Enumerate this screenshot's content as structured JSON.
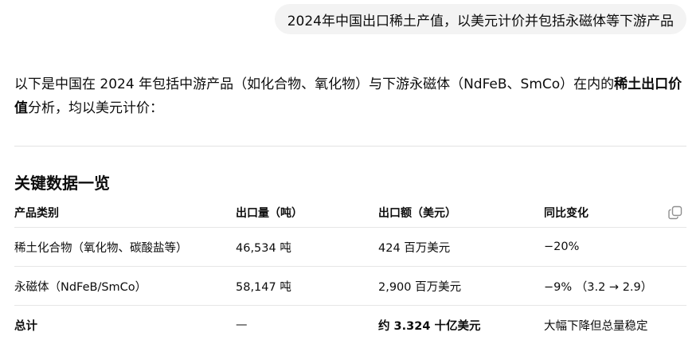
{
  "user_message": "2024年中国出口稀土产值，以美元计价并包括永磁体等下游产品",
  "intro": {
    "text_before": "以下是中国在 2024 年包括中游产品（如化合物、氧化物）与下游永磁体（NdFeB、SmCo）在内的",
    "text_bold": "稀土出口价值",
    "text_after": "分析，均以美元计价："
  },
  "section_title": "关键数据一览",
  "table": {
    "headers": [
      "产品类别",
      "出口量（吨）",
      "出口额（美元）",
      "同比变化"
    ],
    "rows": [
      [
        "稀土化合物（氧化物、碳酸盐等）",
        "46,534 吨",
        "424 百万美元",
        "−20%"
      ],
      [
        "永磁体（NdFeB/SmCo）",
        "58,147 吨",
        "2,900 百万美元",
        "−9% （3.2 → 2.9）"
      ],
      [
        "总计",
        "—",
        "约 3.324 十亿美元",
        "大幅下降但总量稳定"
      ]
    ]
  },
  "icons": {
    "copy": "copy-icon"
  }
}
